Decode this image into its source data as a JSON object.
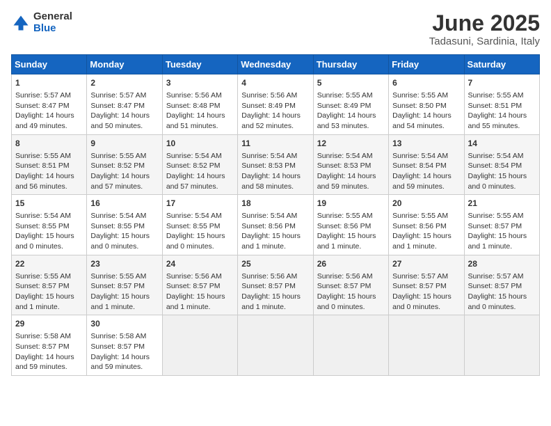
{
  "header": {
    "logo_general": "General",
    "logo_blue": "Blue",
    "month_title": "June 2025",
    "location": "Tadasuni, Sardinia, Italy"
  },
  "weekdays": [
    "Sunday",
    "Monday",
    "Tuesday",
    "Wednesday",
    "Thursday",
    "Friday",
    "Saturday"
  ],
  "weeks": [
    [
      {
        "day": "1",
        "info": "Sunrise: 5:57 AM\nSunset: 8:47 PM\nDaylight: 14 hours\nand 49 minutes."
      },
      {
        "day": "2",
        "info": "Sunrise: 5:57 AM\nSunset: 8:47 PM\nDaylight: 14 hours\nand 50 minutes."
      },
      {
        "day": "3",
        "info": "Sunrise: 5:56 AM\nSunset: 8:48 PM\nDaylight: 14 hours\nand 51 minutes."
      },
      {
        "day": "4",
        "info": "Sunrise: 5:56 AM\nSunset: 8:49 PM\nDaylight: 14 hours\nand 52 minutes."
      },
      {
        "day": "5",
        "info": "Sunrise: 5:55 AM\nSunset: 8:49 PM\nDaylight: 14 hours\nand 53 minutes."
      },
      {
        "day": "6",
        "info": "Sunrise: 5:55 AM\nSunset: 8:50 PM\nDaylight: 14 hours\nand 54 minutes."
      },
      {
        "day": "7",
        "info": "Sunrise: 5:55 AM\nSunset: 8:51 PM\nDaylight: 14 hours\nand 55 minutes."
      }
    ],
    [
      {
        "day": "8",
        "info": "Sunrise: 5:55 AM\nSunset: 8:51 PM\nDaylight: 14 hours\nand 56 minutes."
      },
      {
        "day": "9",
        "info": "Sunrise: 5:55 AM\nSunset: 8:52 PM\nDaylight: 14 hours\nand 57 minutes."
      },
      {
        "day": "10",
        "info": "Sunrise: 5:54 AM\nSunset: 8:52 PM\nDaylight: 14 hours\nand 57 minutes."
      },
      {
        "day": "11",
        "info": "Sunrise: 5:54 AM\nSunset: 8:53 PM\nDaylight: 14 hours\nand 58 minutes."
      },
      {
        "day": "12",
        "info": "Sunrise: 5:54 AM\nSunset: 8:53 PM\nDaylight: 14 hours\nand 59 minutes."
      },
      {
        "day": "13",
        "info": "Sunrise: 5:54 AM\nSunset: 8:54 PM\nDaylight: 14 hours\nand 59 minutes."
      },
      {
        "day": "14",
        "info": "Sunrise: 5:54 AM\nSunset: 8:54 PM\nDaylight: 15 hours\nand 0 minutes."
      }
    ],
    [
      {
        "day": "15",
        "info": "Sunrise: 5:54 AM\nSunset: 8:55 PM\nDaylight: 15 hours\nand 0 minutes."
      },
      {
        "day": "16",
        "info": "Sunrise: 5:54 AM\nSunset: 8:55 PM\nDaylight: 15 hours\nand 0 minutes."
      },
      {
        "day": "17",
        "info": "Sunrise: 5:54 AM\nSunset: 8:55 PM\nDaylight: 15 hours\nand 0 minutes."
      },
      {
        "day": "18",
        "info": "Sunrise: 5:54 AM\nSunset: 8:56 PM\nDaylight: 15 hours\nand 1 minute."
      },
      {
        "day": "19",
        "info": "Sunrise: 5:55 AM\nSunset: 8:56 PM\nDaylight: 15 hours\nand 1 minute."
      },
      {
        "day": "20",
        "info": "Sunrise: 5:55 AM\nSunset: 8:56 PM\nDaylight: 15 hours\nand 1 minute."
      },
      {
        "day": "21",
        "info": "Sunrise: 5:55 AM\nSunset: 8:57 PM\nDaylight: 15 hours\nand 1 minute."
      }
    ],
    [
      {
        "day": "22",
        "info": "Sunrise: 5:55 AM\nSunset: 8:57 PM\nDaylight: 15 hours\nand 1 minute."
      },
      {
        "day": "23",
        "info": "Sunrise: 5:55 AM\nSunset: 8:57 PM\nDaylight: 15 hours\nand 1 minute."
      },
      {
        "day": "24",
        "info": "Sunrise: 5:56 AM\nSunset: 8:57 PM\nDaylight: 15 hours\nand 1 minute."
      },
      {
        "day": "25",
        "info": "Sunrise: 5:56 AM\nSunset: 8:57 PM\nDaylight: 15 hours\nand 1 minute."
      },
      {
        "day": "26",
        "info": "Sunrise: 5:56 AM\nSunset: 8:57 PM\nDaylight: 15 hours\nand 0 minutes."
      },
      {
        "day": "27",
        "info": "Sunrise: 5:57 AM\nSunset: 8:57 PM\nDaylight: 15 hours\nand 0 minutes."
      },
      {
        "day": "28",
        "info": "Sunrise: 5:57 AM\nSunset: 8:57 PM\nDaylight: 15 hours\nand 0 minutes."
      }
    ],
    [
      {
        "day": "29",
        "info": "Sunrise: 5:58 AM\nSunset: 8:57 PM\nDaylight: 14 hours\nand 59 minutes."
      },
      {
        "day": "30",
        "info": "Sunrise: 5:58 AM\nSunset: 8:57 PM\nDaylight: 14 hours\nand 59 minutes."
      },
      {
        "day": "",
        "info": ""
      },
      {
        "day": "",
        "info": ""
      },
      {
        "day": "",
        "info": ""
      },
      {
        "day": "",
        "info": ""
      },
      {
        "day": "",
        "info": ""
      }
    ]
  ]
}
